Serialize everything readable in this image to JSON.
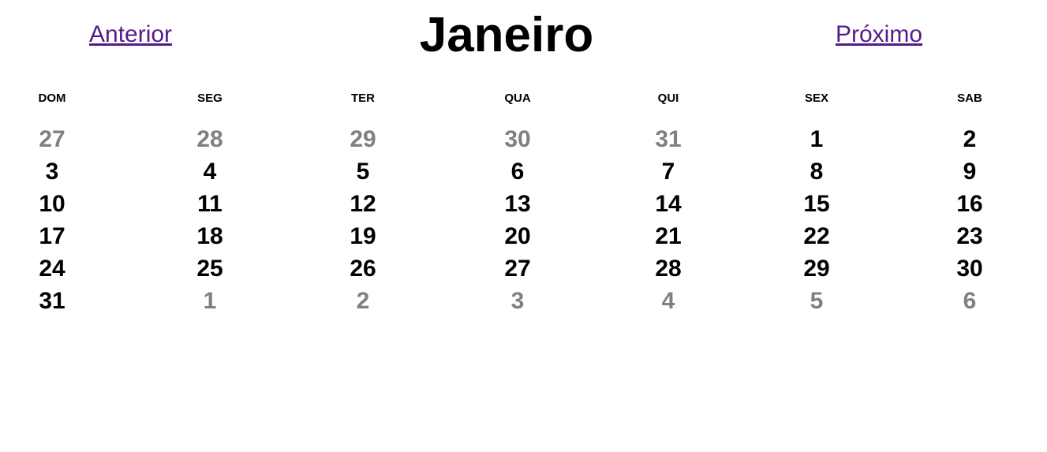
{
  "nav": {
    "prev_label": "Anterior",
    "next_label": "Próximo",
    "link_color": "#551a8b"
  },
  "month": {
    "title": "Janeiro"
  },
  "weekdays": [
    "DOM",
    "SEG",
    "TER",
    "QUA",
    "QUI",
    "SEX",
    "SAB"
  ],
  "weeks": [
    [
      {
        "day": "27",
        "outside": true
      },
      {
        "day": "28",
        "outside": true
      },
      {
        "day": "29",
        "outside": true
      },
      {
        "day": "30",
        "outside": true
      },
      {
        "day": "31",
        "outside": true
      },
      {
        "day": "1",
        "outside": false
      },
      {
        "day": "2",
        "outside": false
      }
    ],
    [
      {
        "day": "3",
        "outside": false
      },
      {
        "day": "4",
        "outside": false
      },
      {
        "day": "5",
        "outside": false
      },
      {
        "day": "6",
        "outside": false
      },
      {
        "day": "7",
        "outside": false
      },
      {
        "day": "8",
        "outside": false
      },
      {
        "day": "9",
        "outside": false
      }
    ],
    [
      {
        "day": "10",
        "outside": false
      },
      {
        "day": "11",
        "outside": false
      },
      {
        "day": "12",
        "outside": false
      },
      {
        "day": "13",
        "outside": false
      },
      {
        "day": "14",
        "outside": false
      },
      {
        "day": "15",
        "outside": false
      },
      {
        "day": "16",
        "outside": false
      }
    ],
    [
      {
        "day": "17",
        "outside": false
      },
      {
        "day": "18",
        "outside": false
      },
      {
        "day": "19",
        "outside": false
      },
      {
        "day": "20",
        "outside": false
      },
      {
        "day": "21",
        "outside": false
      },
      {
        "day": "22",
        "outside": false
      },
      {
        "day": "23",
        "outside": false
      }
    ],
    [
      {
        "day": "24",
        "outside": false
      },
      {
        "day": "25",
        "outside": false
      },
      {
        "day": "26",
        "outside": false
      },
      {
        "day": "27",
        "outside": false
      },
      {
        "day": "28",
        "outside": false
      },
      {
        "day": "29",
        "outside": false
      },
      {
        "day": "30",
        "outside": false
      }
    ],
    [
      {
        "day": "31",
        "outside": false
      },
      {
        "day": "1",
        "outside": true
      },
      {
        "day": "2",
        "outside": true
      },
      {
        "day": "3",
        "outside": true
      },
      {
        "day": "4",
        "outside": true
      },
      {
        "day": "5",
        "outside": true
      },
      {
        "day": "6",
        "outside": true
      }
    ]
  ],
  "colors": {
    "current_month_day": "#000000",
    "other_month_day": "#808080"
  }
}
